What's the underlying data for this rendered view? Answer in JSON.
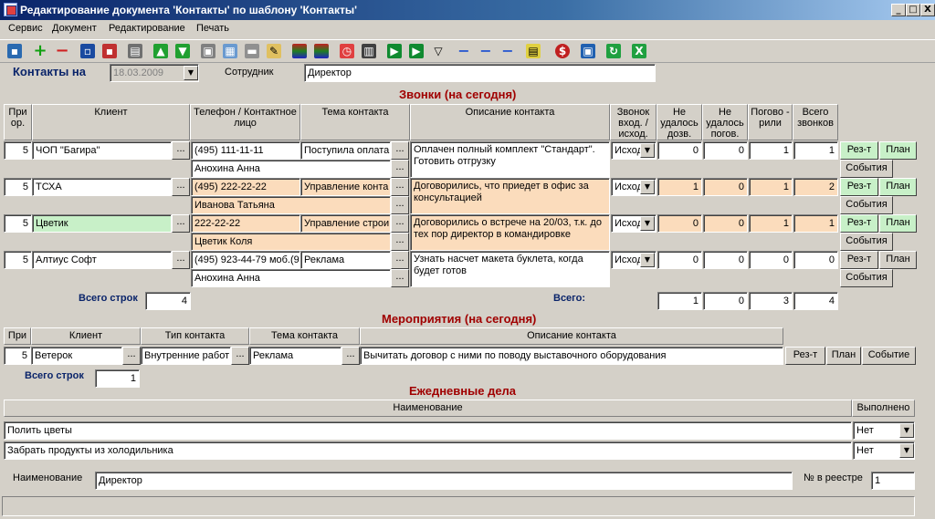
{
  "window": {
    "title": "Редактирование документа 'Контакты' по шаблону 'Контакты'",
    "min": "_",
    "max": "□",
    "close": "X"
  },
  "menu": [
    "Сервис",
    "Документ",
    "Редактирование",
    "Печать"
  ],
  "header": {
    "contacts_label": "Контакты на",
    "date": "18.03.2009",
    "employee_label": "Сотрудник",
    "employee": "Директор"
  },
  "calls": {
    "title": "Звонки (на сегодня)",
    "cols": [
      "При ор.",
      "Клиент",
      "Телефон / Контактное лицо",
      "Тема контакта",
      "Описание контакта",
      "Звонок вход. / исход.",
      "Не удалось дозв.",
      "Не удалось погов.",
      "Погово - рили",
      "Всего звонков"
    ],
    "rows": [
      {
        "prio": "5",
        "client": "ЧОП \"Багира\"",
        "phone": "(495) 111-11-11",
        "person": "Анохина Анна",
        "topic": "Поступила оплата",
        "desc": "Оплачен полный комплект \"Стандарт\". Готовить отгрузку",
        "dir": "Исход",
        "nd": "0",
        "np": "0",
        "talk": "1",
        "total": "1"
      },
      {
        "prio": "5",
        "client": "ТСХА",
        "phone": "(495) 222-22-22",
        "person": "Иванова Татьяна",
        "topic": "Управление конта",
        "desc": "Договорились, что приедет в офис за консультацией",
        "dir": "Исход",
        "nd": "1",
        "np": "0",
        "talk": "1",
        "total": "2"
      },
      {
        "prio": "5",
        "client": "Цветик",
        "phone": "222-22-22",
        "person": "Цветик Коля",
        "topic": "Управление строи",
        "desc": "Договорились о встрече на 20/03, т.к. до тех пор директор в командировке",
        "dir": "Исход",
        "nd": "0",
        "np": "0",
        "talk": "1",
        "total": "1"
      },
      {
        "prio": "5",
        "client": "Алтиус Софт",
        "phone": "(495) 923-44-79 моб.(9",
        "person": "Анохина Анна",
        "topic": "Реклама",
        "desc": "Узнать насчет макета буклета, когда будет готов",
        "dir": "Исход",
        "nd": "0",
        "np": "0",
        "talk": "0",
        "total": "0"
      }
    ],
    "btn_result": "Рез-т",
    "btn_plan": "План",
    "btn_events": "События",
    "rows_label": "Всего строк",
    "rows_count": "4",
    "sum_label": "Всего:",
    "sums": [
      "1",
      "0",
      "3",
      "4"
    ]
  },
  "events": {
    "title": "Мероприятия (на сегодня)",
    "cols": [
      "При",
      "Клиент",
      "Тип контакта",
      "Тема контакта",
      "Описание контакта"
    ],
    "row": {
      "prio": "5",
      "client": "Ветерок",
      "type": "Внутренние работ",
      "topic": "Реклама",
      "desc": "Вычитать договор с ними по поводу выставочного оборудования"
    },
    "btn_result": "Рез-т",
    "btn_plan": "План",
    "btn_event": "Событие",
    "rows_label": "Всего строк",
    "rows_count": "1"
  },
  "daily": {
    "title": "Ежедневные дела",
    "cols": [
      "Наименование",
      "Выполнено"
    ],
    "rows": [
      {
        "name": "Полить цветы",
        "done": "Нет"
      },
      {
        "name": "Забрать продукты из холодильника",
        "done": "Нет"
      }
    ]
  },
  "footer": {
    "name_label": "Наименование",
    "name": "Директор",
    "reg_label": "№ в реестре",
    "reg": "1"
  },
  "colors": {
    "peach": "#fbdcbc",
    "green": "#c8f0c8",
    "title": "#a00000",
    "label": "#0a246a"
  },
  "toolbar_icons": [
    "open-icon",
    "add-icon",
    "remove-icon",
    "save-icon",
    "save-close-icon",
    "print-icon",
    "up-icon",
    "down-icon",
    "copy-icon",
    "table-icon",
    "card-icon",
    "edit-icon",
    "color1-icon",
    "color2-icon",
    "clock-icon",
    "calendar-icon",
    "play-icon",
    "play2-icon",
    "filter-icon",
    "dash1-icon",
    "dash2-icon",
    "dash3-icon",
    "note-icon",
    "money-icon",
    "export-icon",
    "refresh-icon",
    "excel-icon"
  ]
}
